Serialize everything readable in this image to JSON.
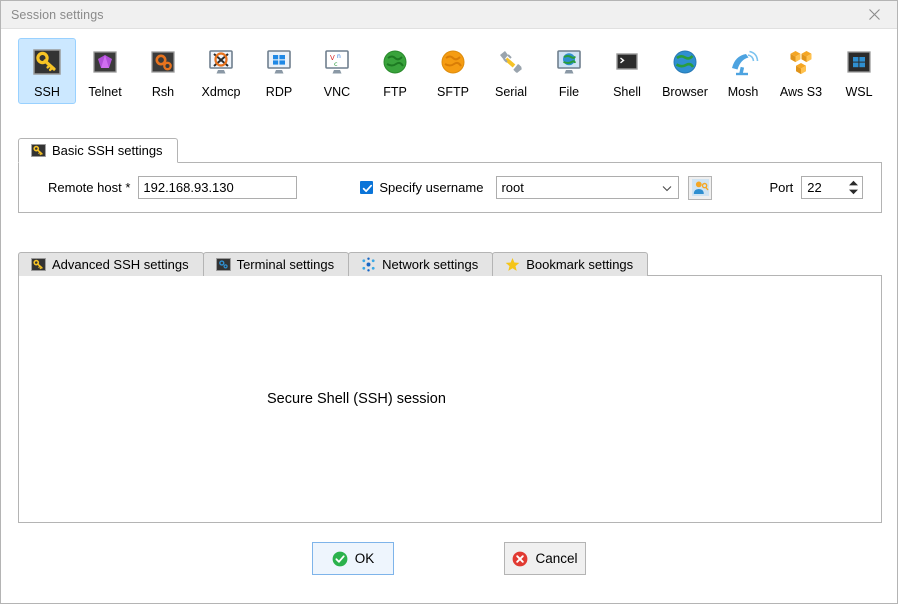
{
  "titlebar": {
    "title": "Session settings",
    "close_icon": "close-icon"
  },
  "session_types": [
    {
      "label": "SSH",
      "icon": "key-icon",
      "selected": true
    },
    {
      "label": "Telnet",
      "icon": "gem-icon",
      "selected": false
    },
    {
      "label": "Rsh",
      "icon": "gears-icon",
      "selected": false
    },
    {
      "label": "Xdmcp",
      "icon": "x-monitor-icon",
      "selected": false
    },
    {
      "label": "RDP",
      "icon": "windows-monitor-icon",
      "selected": false
    },
    {
      "label": "VNC",
      "icon": "vnc-monitor-icon",
      "selected": false
    },
    {
      "label": "FTP",
      "icon": "green-globe-icon",
      "selected": false
    },
    {
      "label": "SFTP",
      "icon": "orange-globe-icon",
      "selected": false
    },
    {
      "label": "Serial",
      "icon": "plug-icon",
      "selected": false
    },
    {
      "label": "File",
      "icon": "globe-monitor-icon",
      "selected": false
    },
    {
      "label": "Shell",
      "icon": "terminal-icon",
      "selected": false
    },
    {
      "label": "Browser",
      "icon": "blue-globe-icon",
      "selected": false
    },
    {
      "label": "Mosh",
      "icon": "satellite-icon",
      "selected": false
    },
    {
      "label": "Aws S3",
      "icon": "aws-cubes-icon",
      "selected": false
    },
    {
      "label": "WSL",
      "icon": "windows-logo-icon",
      "selected": false
    }
  ],
  "basic": {
    "tab_label": "Basic SSH settings",
    "tab_icon": "key-icon",
    "remote_host_label": "Remote host *",
    "remote_host_value": "192.168.93.130",
    "remote_host_placeholder": "",
    "specify_username_label": "Specify username",
    "specify_username_checked": true,
    "username_value": "root",
    "username_placeholder": "",
    "user_key_button_icon": "user-key-icon",
    "port_label": "Port",
    "port_value": "22"
  },
  "lower_tabs": [
    {
      "label": "Advanced SSH settings",
      "icon": "key-icon",
      "active": false
    },
    {
      "label": "Terminal settings",
      "icon": "gears-icon",
      "active": false
    },
    {
      "label": "Network settings",
      "icon": "nodes-icon",
      "active": false
    },
    {
      "label": "Bookmark settings",
      "icon": "star-icon",
      "active": false
    }
  ],
  "lower_panel": {
    "description": "Secure Shell (SSH) session",
    "badge_icon": "key-icon"
  },
  "buttons": {
    "ok_label": "OK",
    "ok_icon": "check-circle-icon",
    "cancel_label": "Cancel",
    "cancel_icon": "x-circle-icon"
  },
  "colors": {
    "selection_blue": "#cce8ff",
    "checkbox_blue": "#0a74d8",
    "key_yellow": "#f7c325",
    "ok_green": "#2bb24c",
    "cancel_red": "#e13a32",
    "default_button_border": "#7eb4ea"
  }
}
